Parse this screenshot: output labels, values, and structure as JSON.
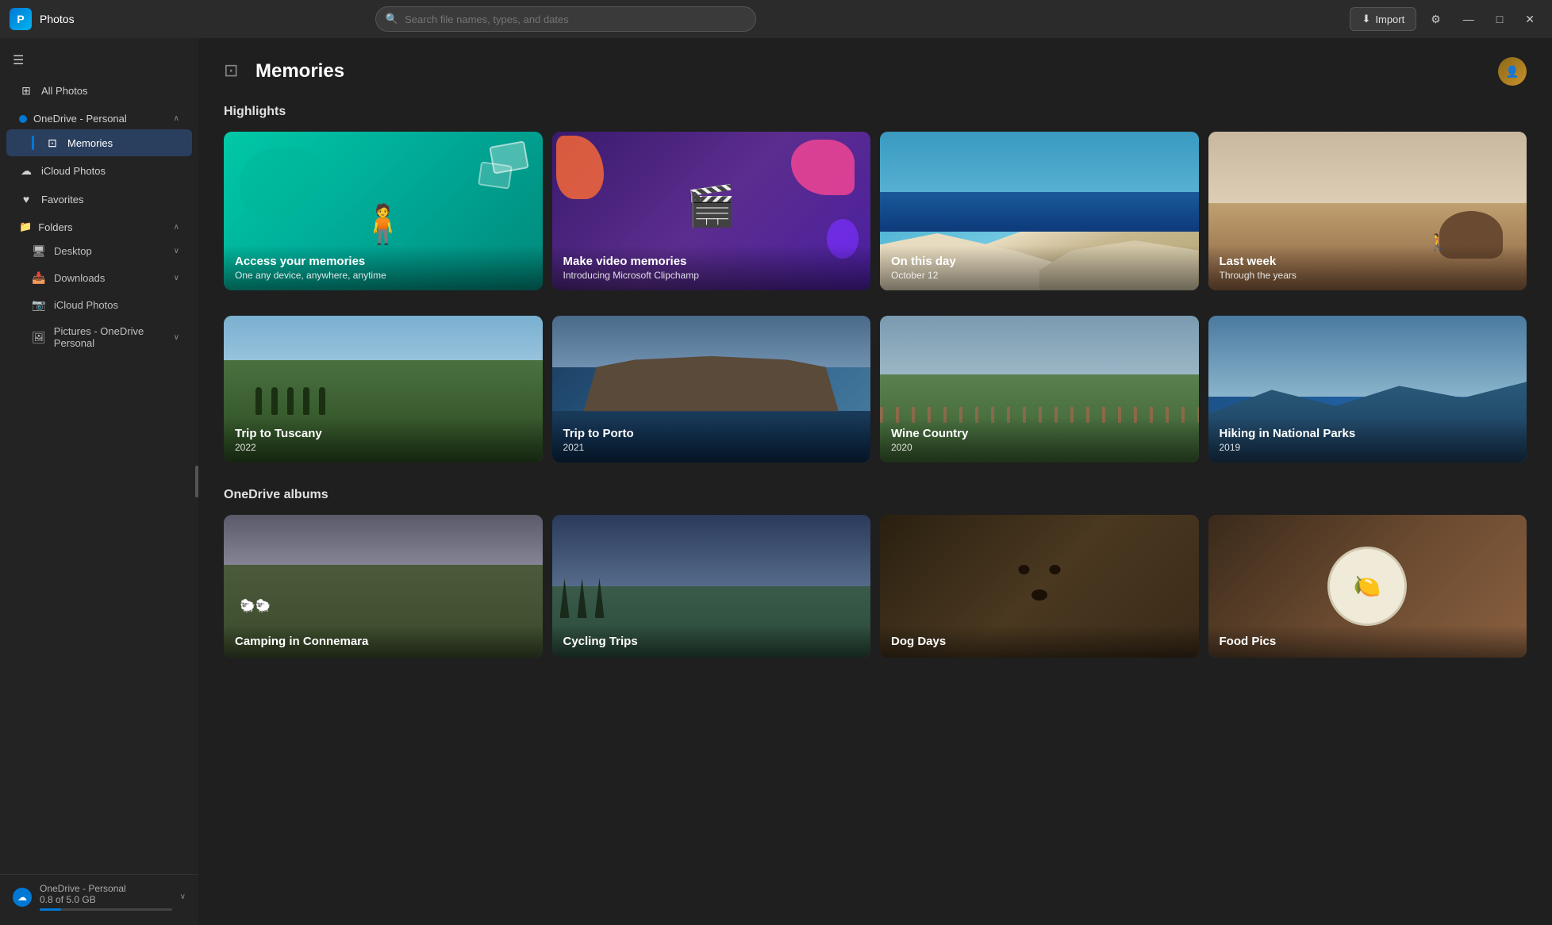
{
  "titlebar": {
    "app_name": "Photos",
    "logo_letter": "P",
    "search_placeholder": "Search file names, types, and dates",
    "import_label": "Import",
    "import_icon": "⬇",
    "gear_icon": "⚙",
    "minimize_icon": "—",
    "maximize_icon": "□",
    "close_icon": "✕"
  },
  "sidebar": {
    "hamburger_icon": "☰",
    "all_photos_label": "All Photos",
    "all_photos_icon": "⊞",
    "onedrive_label": "OneDrive - Personal",
    "onedrive_icon": "☁",
    "onedrive_chevron": "∧",
    "memories_label": "Memories",
    "memories_icon": "⊡",
    "icloud_label": "iCloud Photos",
    "icloud_icon": "☁",
    "favorites_label": "Favorites",
    "favorites_icon": "♥",
    "folders_label": "Folders",
    "folders_icon": "📁",
    "folders_chevron": "∧",
    "desktop_label": "Desktop",
    "desktop_icon": "🖥",
    "desktop_chevron": "∨",
    "downloads_label": "Downloads",
    "downloads_icon": "📥",
    "downloads_chevron": "∨",
    "icloud_photos_label": "iCloud Photos",
    "icloud_photos_icon": "📷",
    "pictures_label": "Pictures - OneDrive Personal",
    "pictures_icon": "🖼",
    "pictures_chevron": "∨",
    "storage_label": "OneDrive - Personal",
    "storage_amount": "0.8 of 5.0 GB",
    "storage_fill_percent": 16
  },
  "main": {
    "page_title": "Memories",
    "page_icon": "⊡",
    "highlights_section": "Highlights",
    "albums_section": "OneDrive albums",
    "highlights": [
      {
        "id": "access-memories",
        "type": "illustrated",
        "title": "Access your memories",
        "subtitle": "One any device, anywhere, anytime",
        "style": "teal"
      },
      {
        "id": "make-video",
        "type": "illustrated",
        "title": "Make video memories",
        "subtitle": "Introducing Microsoft Clipchamp",
        "style": "purple"
      },
      {
        "id": "on-this-day",
        "type": "photo",
        "title": "On this day",
        "subtitle": "October 12",
        "style": "cliff"
      },
      {
        "id": "last-week",
        "type": "photo",
        "title": "Last week",
        "subtitle": "Through the years",
        "style": "desert"
      }
    ],
    "memories": [
      {
        "id": "tuscany",
        "title": "Trip to Tuscany",
        "year": "2022",
        "style": "tuscany"
      },
      {
        "id": "porto",
        "title": "Trip to Porto",
        "year": "2021",
        "style": "porto"
      },
      {
        "id": "wine-country",
        "title": "Wine Country",
        "year": "2020",
        "style": "wine"
      },
      {
        "id": "national-parks",
        "title": "Hiking in National Parks",
        "year": "2019",
        "style": "national-parks"
      }
    ],
    "albums": [
      {
        "id": "connemara",
        "title": "Camping in Connemara",
        "style": "connemara"
      },
      {
        "id": "cycling",
        "title": "Cycling Trips",
        "style": "cycling"
      },
      {
        "id": "dog",
        "title": "Dog Days",
        "style": "dog"
      },
      {
        "id": "food",
        "title": "Food Pics",
        "style": "food"
      }
    ]
  }
}
